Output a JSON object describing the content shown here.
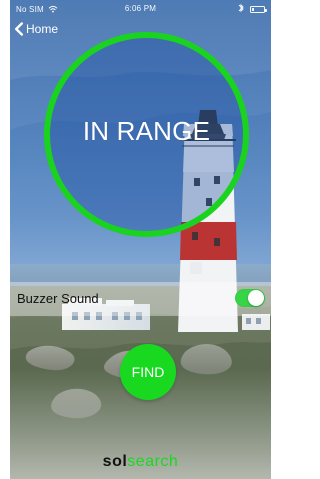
{
  "status_bar": {
    "carrier": "No SIM",
    "time": "6:06 PM",
    "icons": {
      "wifi": "wifi-icon",
      "bluetooth": "bluetooth-icon",
      "battery": "battery-icon"
    },
    "battery_level_fraction": 0.15
  },
  "nav": {
    "back_label": "Home",
    "back_icon": "chevron-left-icon"
  },
  "range": {
    "status_text": "IN RANGE",
    "ring_color": "#1ad31e"
  },
  "settings": {
    "buzzer_label": "Buzzer Sound",
    "buzzer_enabled": true,
    "toggle_color": "#37d447"
  },
  "actions": {
    "find_label": "FIND",
    "find_color": "#18d91f"
  },
  "branding": {
    "part1": "sol",
    "part2": "search"
  }
}
